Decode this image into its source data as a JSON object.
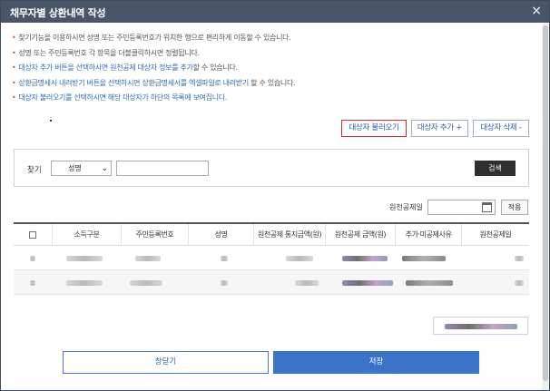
{
  "window": {
    "title": "채무자별 상환내역 작성",
    "close_glyph": "×"
  },
  "info": {
    "lines": [
      {
        "pre": "찾기기능을 이용하시면 성명 또는 주민등록번호가 위치한 행으로 편리하게 이동할 수 있습니다.",
        "hl": "",
        "post": ""
      },
      {
        "pre": "성명 또는 주민등록번호 각 항목을 더블클릭하시면 정렬됩니다.",
        "hl": "",
        "post": ""
      },
      {
        "pre": "",
        "hl": "대상자 추가 버튼을 선택하시면 원천공제 대상자 정보를 추가",
        "post": "할 수 있습니다."
      },
      {
        "pre": "",
        "hl": "상환금명세서 내려받기 버튼을 선택하시면 상환금명세서를 엑셀파일로 내려받기",
        "post": " 할 수 있습니다."
      },
      {
        "pre": "",
        "hl": "대상자 불러오기를 선택하시면 해당 대상자가 하단의 목록에 보여집니다.",
        "post": ""
      }
    ]
  },
  "actions": {
    "load": "대상자 불러오기",
    "add": "대상자 추가 +",
    "delete": "대상자 삭제 -"
  },
  "search": {
    "label": "찾기",
    "select_value": "성명",
    "input_value": "",
    "button": "검색"
  },
  "date_filter": {
    "label": "원천공제일",
    "value": "",
    "apply": "적용"
  },
  "table": {
    "headers": [
      "",
      "소득구분",
      "주민등록번호",
      "성명",
      "원천공제 통지금액(원)",
      "원천공제 금액(원)",
      "추가·미공제사유",
      "원천공제일"
    ]
  },
  "footer": {
    "cancel": "창닫기",
    "save": "저장"
  }
}
